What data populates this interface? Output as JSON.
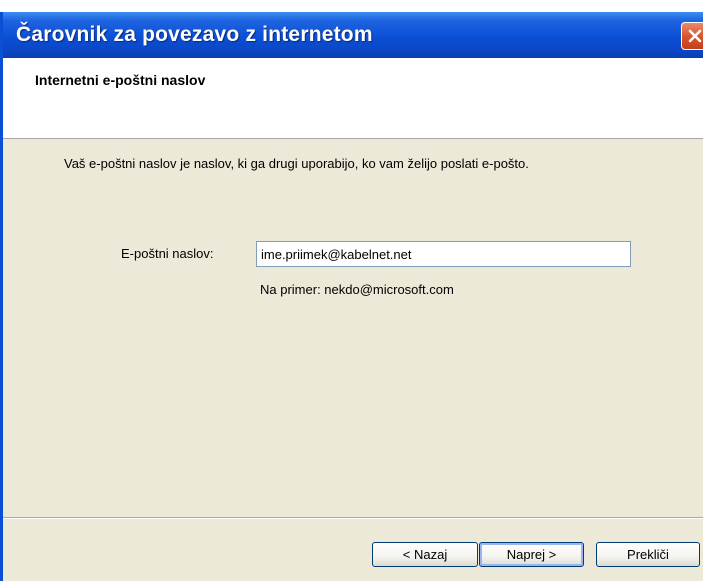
{
  "window": {
    "title": "Čarovnik za povezavo z internetom"
  },
  "header": {
    "title": "Internetni e-poštni naslov"
  },
  "main": {
    "description": "Vaš e-poštni naslov je naslov, ki ga drugi uporabijo, ko vam želijo poslati e-pošto.",
    "email_label": "E-poštni naslov:",
    "email_value": "ime.priimek@kabelnet.net",
    "example": "Na primer: nekdo@microsoft.com"
  },
  "buttons": {
    "back": "< Nazaj",
    "next": "Naprej >",
    "cancel": "Prekliči"
  },
  "colors": {
    "titlebar": "#0b4fd6",
    "close_button": "#d8522b",
    "dialog_background": "#ece9d8"
  },
  "icons": {
    "close": "close-icon"
  }
}
